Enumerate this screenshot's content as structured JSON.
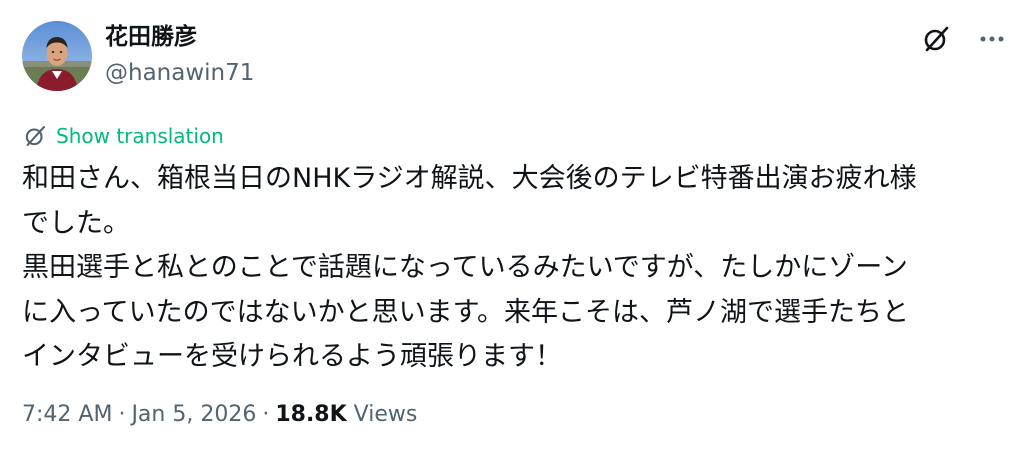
{
  "tweet": {
    "author": {
      "display_name": "花田勝彦",
      "handle": "@hanawin71",
      "avatar": "profile-photo"
    },
    "actions": {
      "grok_icon": "grok-icon",
      "more_icon": "more-horizontal-icon"
    },
    "translate": {
      "icon": "translate-icon",
      "label": "Show translation"
    },
    "body_lines": [
      "和田さん、箱根当日のNHKラジオ解説、大会後のテレビ特番出演お疲れ様",
      "でした。",
      "黒田選手と私とのことで話題になっているみたいですが、たしかにゾーン",
      "に入っていたのではないかと思います。来年こそは、芦ノ湖で選手たちと",
      "インタビューを受けられるよう頑張ります！"
    ],
    "meta": {
      "time": "7:42 AM",
      "separator": "·",
      "date": "Jan 5, 2026",
      "views_count": "18.8K",
      "views_label": "Views"
    },
    "colors": {
      "text": "#0f1419",
      "secondary": "#536471",
      "translate_accent": "#00ba7c"
    }
  }
}
